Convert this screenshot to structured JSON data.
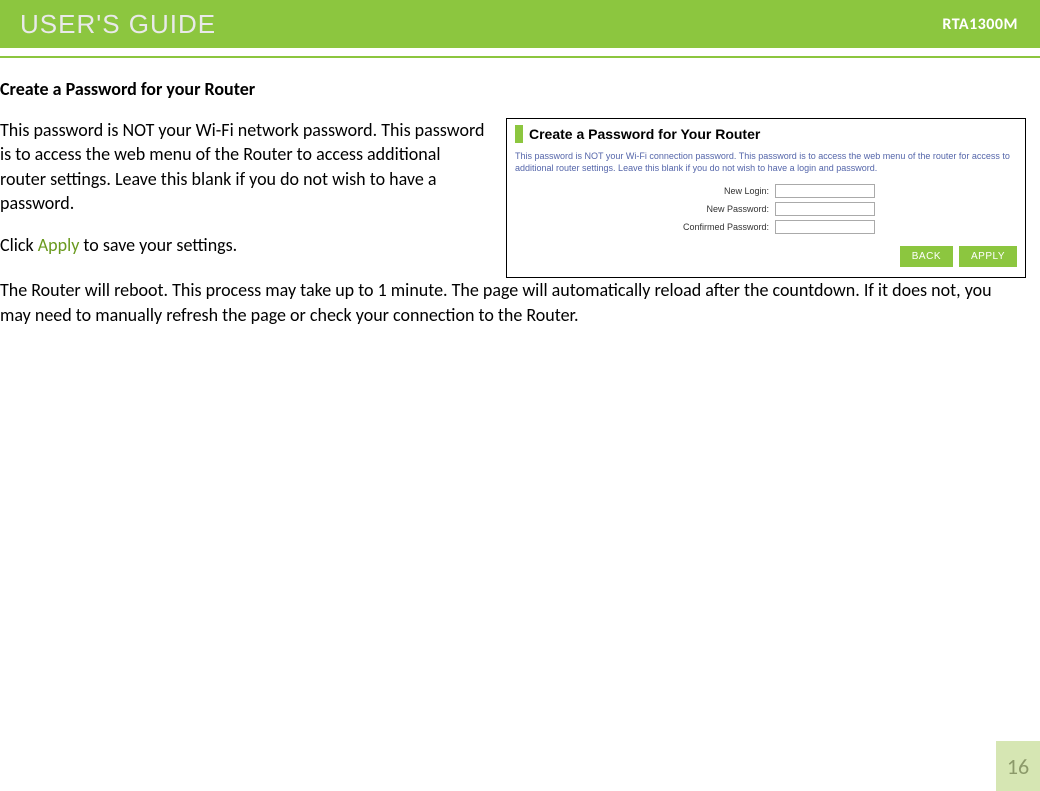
{
  "header": {
    "title": "USER'S GUIDE",
    "model": "RTA1300M"
  },
  "section": {
    "heading": "Create a Password for your Router",
    "para1": "This password is NOT your Wi-Fi network password. This password is to access the web menu of the Router to access additional router settings. Leave this blank if you do not wish to have a password.",
    "para2_pre": "Click ",
    "para2_apply": "Apply",
    "para2_post": " to save your settings.",
    "para3": "The Router will reboot. This process may take up to 1 minute. The page will automatically reload after the countdown. If it does not, you may need to manually refresh the page or check your connection to the Router."
  },
  "panel": {
    "title": "Create a Password for Your Router",
    "desc": "This password is NOT your Wi-Fi connection password. This password is to access the web menu of the router for access to additional router settings. Leave this blank if you do not wish to have a login and password.",
    "fields": {
      "login_label": "New Login:",
      "password_label": "New Password:",
      "confirm_label": "Confirmed Password:"
    },
    "buttons": {
      "back": "BACK",
      "apply": "APPLY"
    }
  },
  "page_number": "16"
}
